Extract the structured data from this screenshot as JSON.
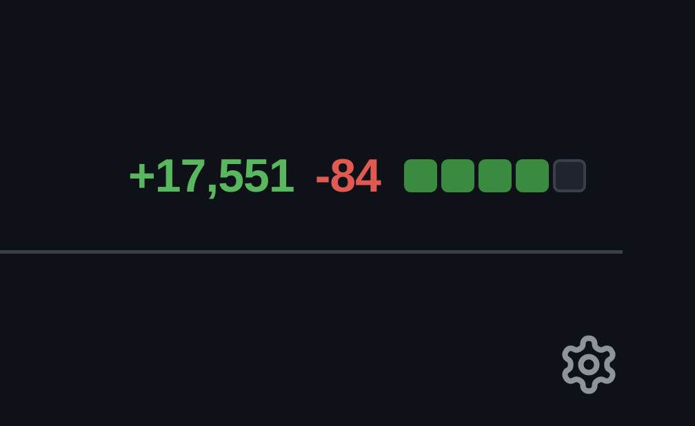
{
  "diffstat": {
    "additions": "+17,551",
    "deletions": "-84",
    "blocks": [
      {
        "state": "added",
        "color": "#3a8a3f"
      },
      {
        "state": "added",
        "color": "#3a8a3f"
      },
      {
        "state": "added",
        "color": "#3a8a3f"
      },
      {
        "state": "added",
        "color": "#3a8a3f"
      },
      {
        "state": "neutral",
        "color": "#20242c"
      }
    ],
    "additions_color": "#59b85f",
    "deletions_color": "#e05a51"
  },
  "settings": {
    "icon": "gear-icon",
    "icon_color": "#8f949b"
  },
  "theme": {
    "background": "#0e1117",
    "divider": "#3b3f47"
  }
}
